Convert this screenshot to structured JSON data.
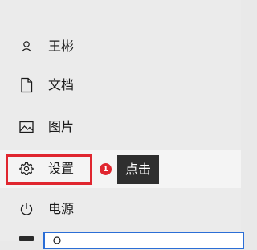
{
  "start_menu": {
    "items": [
      {
        "icon": "user-icon",
        "label": "王彬"
      },
      {
        "icon": "document-icon",
        "label": "文档"
      },
      {
        "icon": "pictures-icon",
        "label": "图片"
      },
      {
        "icon": "gear-icon",
        "label": "设置"
      },
      {
        "icon": "power-icon",
        "label": "电源"
      }
    ]
  },
  "annotation": {
    "step_number": "1",
    "label": "点击"
  },
  "colors": {
    "highlight": "#e0262f",
    "callout_background": "#2f2f2f",
    "search_border": "#2b6ed6",
    "menu_background": "#ebebeb"
  }
}
